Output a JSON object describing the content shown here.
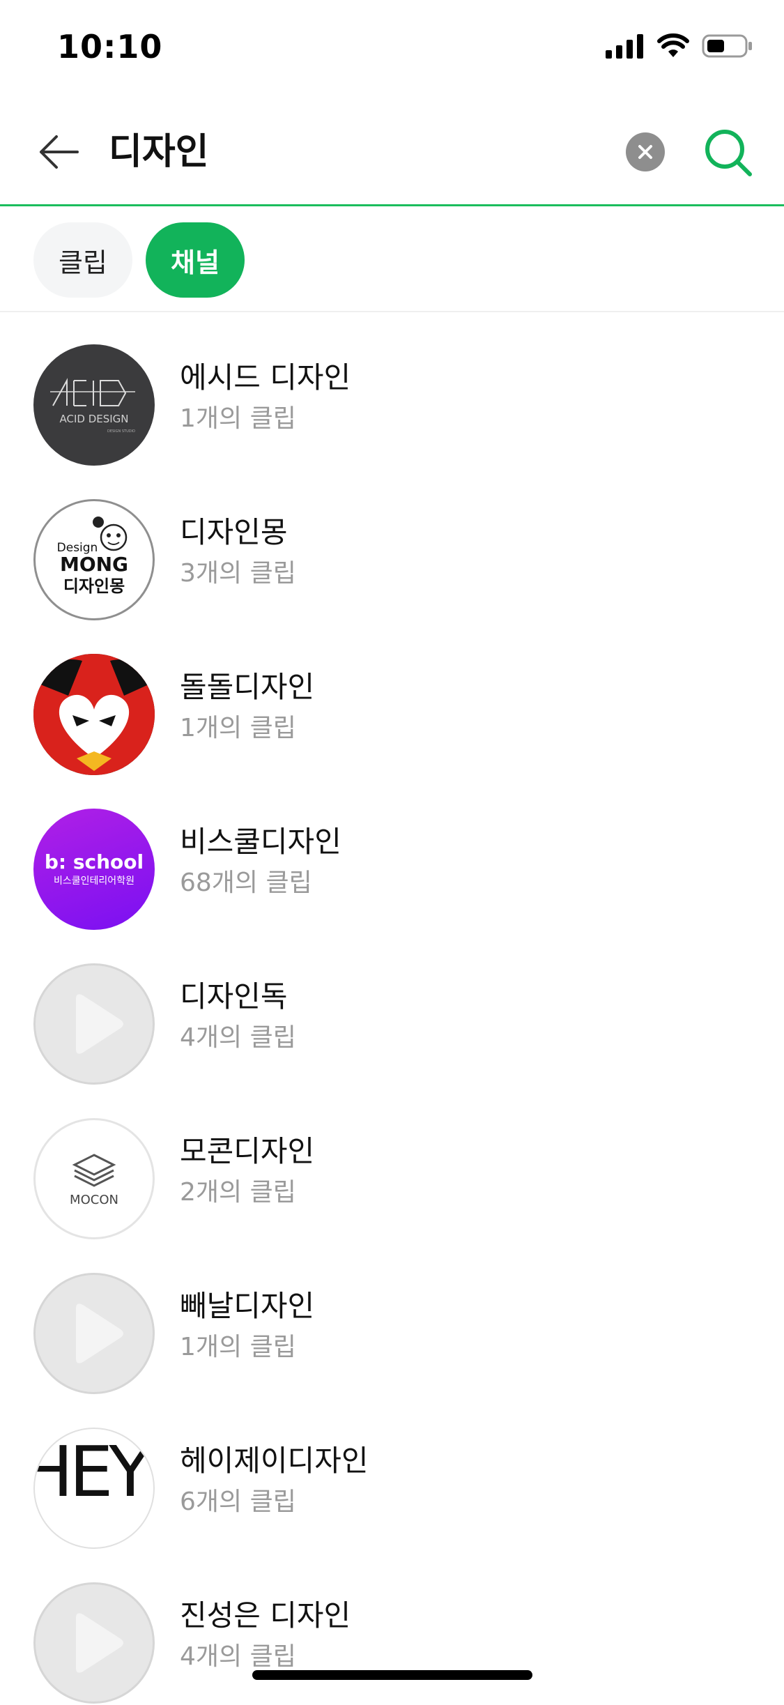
{
  "status_bar": {
    "time": "10:10"
  },
  "search": {
    "query": "디자인"
  },
  "tabs": {
    "clip": "클립",
    "channel": "채널"
  },
  "channels": [
    {
      "name": "에시드 디자인",
      "count": "1개의 클립",
      "avatar": "acid-design-logo",
      "avatar_text": "ACID DESIGN"
    },
    {
      "name": "디자인몽",
      "count": "3개의 클립",
      "avatar": "design-mong-logo",
      "avatar_text_1": "Design",
      "avatar_text_2": "MONG",
      "avatar_text_3": "디자인몽"
    },
    {
      "name": "돌돌디자인",
      "count": "1개의 클립",
      "avatar": "red-character-icon"
    },
    {
      "name": "비스쿨디자인",
      "count": "68개의 클립",
      "avatar": "bschool-logo",
      "avatar_text_1": "b: school",
      "avatar_text_2": "비스쿨인테리어학원"
    },
    {
      "name": "디자인독",
      "count": "4개의 클립",
      "avatar": "default-play-icon"
    },
    {
      "name": "모콘디자인",
      "count": "2개의 클립",
      "avatar": "mocon-logo",
      "avatar_text": "MOCON"
    },
    {
      "name": "빼날디자인",
      "count": "1개의 클립",
      "avatar": "default-play-icon"
    },
    {
      "name": "헤이제이디자인",
      "count": "6개의 클립",
      "avatar": "heyjay-logo",
      "avatar_text": "HEY JAY"
    },
    {
      "name": "진성은 디자인",
      "count": "4개의 클립",
      "avatar": "default-play-icon"
    }
  ],
  "colors": {
    "accent": "#12b35a",
    "underline": "#1bbd5d",
    "count_text": "#9a9a9a"
  }
}
